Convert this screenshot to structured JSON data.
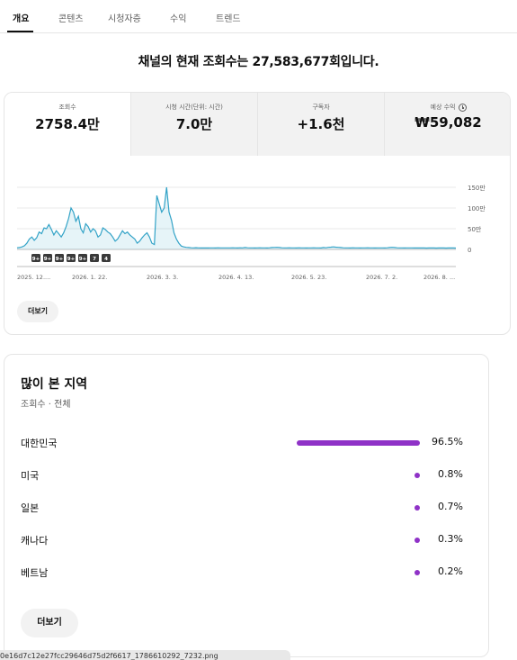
{
  "tabs": [
    "개요",
    "콘텐츠",
    "시청자층",
    "수익",
    "트렌드"
  ],
  "headline": "채널의 현재 조회수는 27,583,677회입니다.",
  "metrics": [
    {
      "label": "조회수",
      "value": "2758.4만"
    },
    {
      "label": "시청 시간(단위: 시간)",
      "value": "7.0만"
    },
    {
      "label": "구독자",
      "value": "+1.6천"
    },
    {
      "label": "예상 수익",
      "value": "₩59,082"
    }
  ],
  "chart_data": {
    "type": "area",
    "y_tick_labels": [
      "150만",
      "100만",
      "50만",
      "0"
    ],
    "y_ticks": [
      1500000,
      1000000,
      500000,
      0
    ],
    "ylim": [
      0,
      1500000
    ],
    "x_tick_labels": [
      "2025. 12....",
      "2026. 1. 22.",
      "2026. 3. 3.",
      "2026. 4. 13.",
      "2026. 5. 23.",
      "2026. 7. 2.",
      "2026. 8. ..."
    ],
    "color": "#33a3c7",
    "values": [
      40000,
      45000,
      60000,
      90000,
      150000,
      250000,
      300000,
      220000,
      280000,
      420000,
      380000,
      520000,
      500000,
      600000,
      480000,
      350000,
      450000,
      380000,
      300000,
      400000,
      550000,
      750000,
      1000000,
      900000,
      680000,
      800000,
      500000,
      400000,
      620000,
      550000,
      420000,
      500000,
      450000,
      300000,
      350000,
      520000,
      480000,
      420000,
      380000,
      300000,
      200000,
      250000,
      350000,
      450000,
      380000,
      420000,
      350000,
      300000,
      250000,
      150000,
      200000,
      280000,
      350000,
      400000,
      300000,
      150000,
      120000,
      1300000,
      1100000,
      900000,
      1000000,
      1500000,
      900000,
      700000,
      400000,
      250000,
      150000,
      80000,
      60000,
      50000,
      45000,
      40000,
      38000,
      42000,
      38000,
      35000,
      36000,
      34000,
      35000,
      38000,
      36000,
      35000,
      40000,
      38000,
      36000,
      37000,
      38000,
      36000,
      40000,
      36000,
      35000,
      40000,
      38000,
      45000,
      40000,
      38000,
      36000,
      35000,
      38000,
      40000,
      38000,
      36000,
      35000,
      40000,
      45000,
      48000,
      50000,
      45000,
      40000,
      38000,
      36000,
      40000,
      38000,
      36000,
      35000,
      40000,
      38000,
      36000,
      35000,
      38000,
      36000,
      40000,
      38000,
      36000,
      35000,
      45000,
      40000,
      50000,
      55000,
      60000,
      55000,
      50000,
      45000,
      40000,
      38000,
      36000,
      35000,
      40000,
      38000,
      36000,
      35000,
      36000,
      38000,
      40000,
      38000,
      36000,
      35000,
      36000,
      38000,
      36000,
      35000,
      40000,
      45000,
      50000,
      45000,
      40000,
      38000,
      36000,
      35000,
      36000,
      38000,
      36000,
      35000,
      34000,
      36000,
      35000,
      34000,
      33000,
      34000,
      35000,
      34000,
      33000,
      34000,
      35000,
      34000,
      33000,
      34000,
      35000,
      34000,
      33000
    ],
    "markers": [
      "9+",
      "9+",
      "9+",
      "9+",
      "9+",
      "7",
      "4"
    ]
  },
  "more_label": "더보기",
  "regions": {
    "title": "많이 본 지역",
    "subtitle": "조회수 · 전체",
    "rows": [
      {
        "name": "대한민국",
        "pct": "96.5%",
        "value": 96.5
      },
      {
        "name": "미국",
        "pct": "0.8%",
        "value": 0.8
      },
      {
        "name": "일본",
        "pct": "0.7%",
        "value": 0.7
      },
      {
        "name": "캐나다",
        "pct": "0.3%",
        "value": 0.3
      },
      {
        "name": "베트남",
        "pct": "0.2%",
        "value": 0.2
      }
    ],
    "bar_color": "#8f32c7",
    "more_label": "더보기"
  },
  "filename": "0e16d7c12e27fcc29646d75d2f6617_1786610292_7232.png"
}
